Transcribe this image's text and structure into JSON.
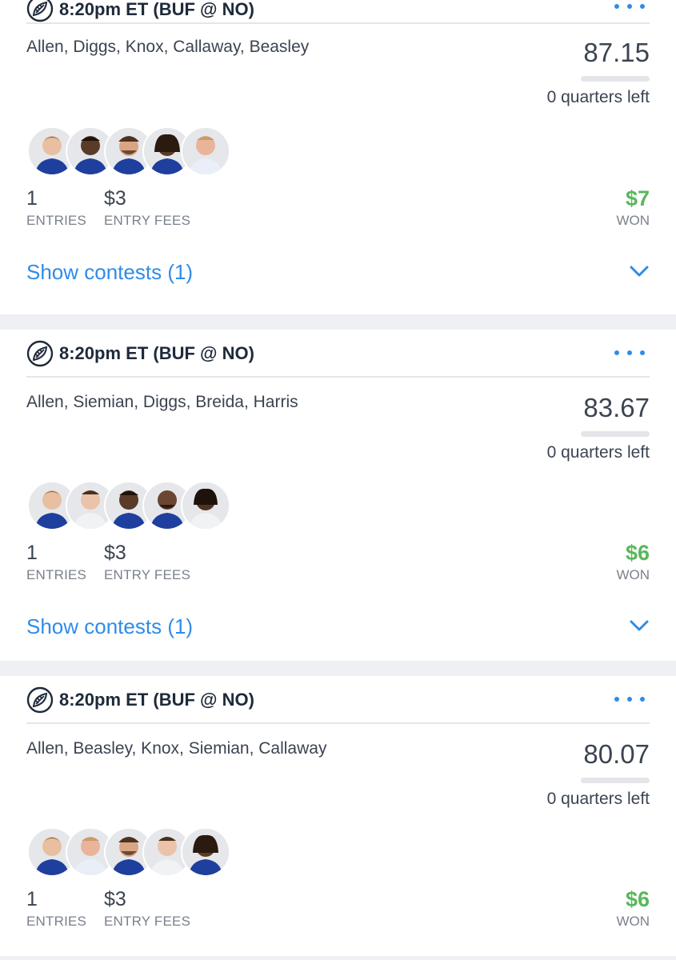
{
  "cards": [
    {
      "game_time": "8:20pm ET (BUF @ NO)",
      "lineup": "Allen, Diggs, Knox, Callaway, Beasley",
      "score": "87.15",
      "quarters_left": "0 quarters left",
      "progress_fraction": 0,
      "avatars": [
        "player-allen",
        "player-diggs",
        "player-knox",
        "player-callaway",
        "player-beasley"
      ],
      "entries_value": "1",
      "entries_label": "ENTRIES",
      "fees_value": "$3",
      "fees_label": "ENTRY FEES",
      "won_value": "$7",
      "won_label": "WON",
      "show_contests": "Show contests (1)"
    },
    {
      "game_time": "8:20pm ET (BUF @ NO)",
      "lineup": "Allen, Siemian, Diggs, Breida, Harris",
      "score": "83.67",
      "quarters_left": "0 quarters left",
      "progress_fraction": 0,
      "avatars": [
        "player-allen",
        "player-siemian",
        "player-diggs",
        "player-breida",
        "player-harris"
      ],
      "entries_value": "1",
      "entries_label": "ENTRIES",
      "fees_value": "$3",
      "fees_label": "ENTRY FEES",
      "won_value": "$6",
      "won_label": "WON",
      "show_contests": "Show contests (1)"
    },
    {
      "game_time": "8:20pm ET (BUF @ NO)",
      "lineup": "Allen, Beasley, Knox, Siemian, Callaway",
      "score": "80.07",
      "quarters_left": "0 quarters left",
      "progress_fraction": 0,
      "avatars": [
        "player-allen",
        "player-beasley",
        "player-knox",
        "player-siemian",
        "player-callaway"
      ],
      "entries_value": "1",
      "entries_label": "ENTRIES",
      "fees_value": "$3",
      "fees_label": "ENTRY FEES",
      "won_value": "$6",
      "won_label": "WON"
    }
  ],
  "colors": {
    "accent_blue": "#2f8ce8",
    "won_green": "#58b85c",
    "header_text": "#1e2a3a",
    "page_background": "#eef0f3"
  },
  "icons": {
    "game": "football-icon",
    "menu": "more-dots-icon",
    "expand": "chevron-down-icon"
  }
}
